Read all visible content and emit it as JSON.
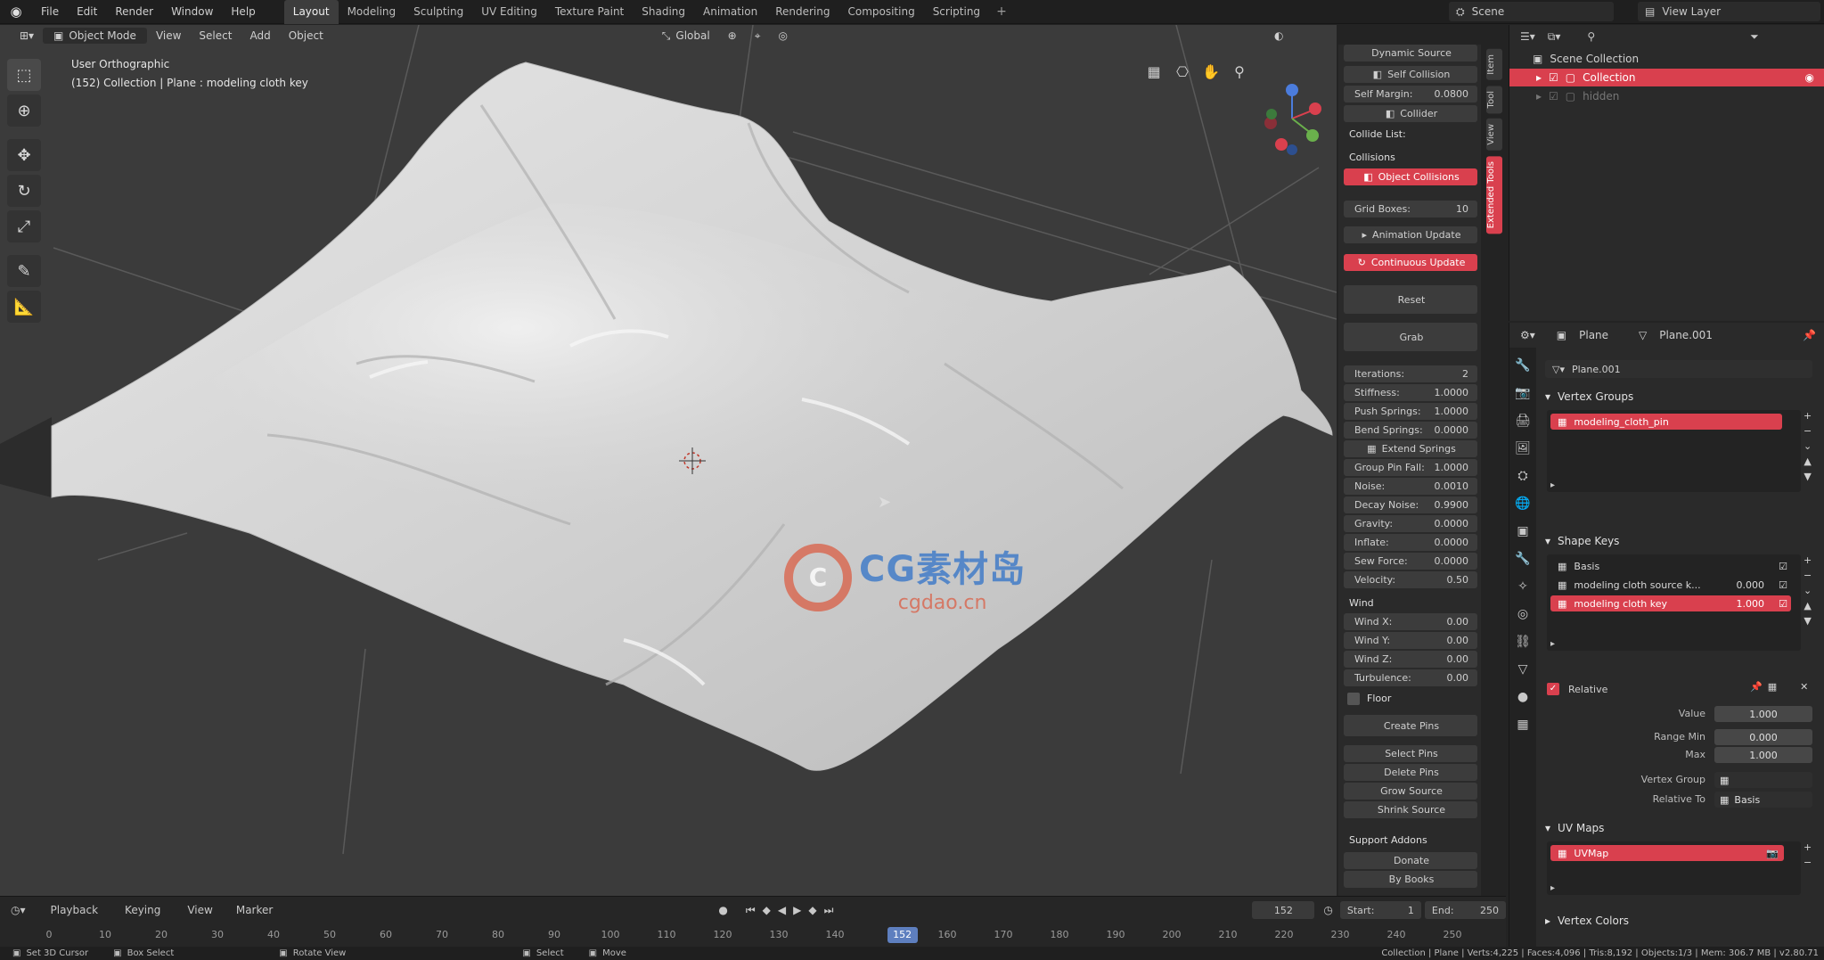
{
  "topbar": {
    "menus": [
      "File",
      "Edit",
      "Render",
      "Window",
      "Help"
    ],
    "tabs": [
      "Layout",
      "Modeling",
      "Sculpting",
      "UV Editing",
      "Texture Paint",
      "Shading",
      "Animation",
      "Rendering",
      "Compositing",
      "Scripting"
    ],
    "active_tab": "Layout",
    "add_tab": "+",
    "scene": "Scene",
    "view_layer": "View Layer"
  },
  "viewport": {
    "mode": "Object Mode",
    "menus": [
      "View",
      "Select",
      "Add",
      "Object"
    ],
    "orientation": "Global",
    "info_line1": "User Orthographic",
    "info_line2": "(152) Collection | Plane : modeling cloth key"
  },
  "watermark": {
    "logo_letter": "C",
    "big": "CG素材岛",
    "small": "cgdao.cn"
  },
  "npanel": {
    "dynamic_source": "Dynamic Source",
    "self_collision": "Self Collision",
    "self_margin_label": "Self Margin:",
    "self_margin_value": "0.0800",
    "collider": "Collider",
    "collide_list": "Collide List:",
    "collisions": "Collisions",
    "object_collisions": "Object Collisions",
    "grid_boxes_label": "Grid Boxes:",
    "grid_boxes_value": "10",
    "animation_update": "Animation Update",
    "continuous_update": "Continuous Update",
    "reset": "Reset",
    "grab": "Grab",
    "params": [
      {
        "label": "Iterations:",
        "value": "2"
      },
      {
        "label": "Stiffness:",
        "value": "1.0000"
      },
      {
        "label": "Push Springs:",
        "value": "1.0000"
      },
      {
        "label": "Bend Springs:",
        "value": "0.0000"
      }
    ],
    "extend_springs": "Extend Springs",
    "params2": [
      {
        "label": "Group Pin Fall:",
        "value": "1.0000"
      },
      {
        "label": "Noise:",
        "value": "0.0010"
      },
      {
        "label": "Decay Noise:",
        "value": "0.9900"
      },
      {
        "label": "Gravity:",
        "value": "0.0000"
      },
      {
        "label": "Inflate:",
        "value": "0.0000"
      },
      {
        "label": "Sew Force:",
        "value": "0.0000"
      },
      {
        "label": "Velocity:",
        "value": "0.50"
      }
    ],
    "wind": "Wind",
    "wind_params": [
      {
        "label": "Wind X:",
        "value": "0.00"
      },
      {
        "label": "Wind Y:",
        "value": "0.00"
      },
      {
        "label": "Wind Z:",
        "value": "0.00"
      },
      {
        "label": "Turbulence:",
        "value": "0.00"
      }
    ],
    "floor": "Floor",
    "create_pins": "Create Pins",
    "pin_buttons": [
      "Select Pins",
      "Delete Pins",
      "Grow Source",
      "Shrink Source"
    ],
    "support_addons": "Support Addons",
    "donate": "Donate",
    "by_books": "By Books"
  },
  "vtabs": [
    "Item",
    "Tool",
    "View",
    "Extended Tools"
  ],
  "outliner": {
    "scene_collection": "Scene Collection",
    "rows": [
      "Collection",
      "hidden"
    ]
  },
  "properties": {
    "object_name": "Plane",
    "mesh_name": "Plane.001",
    "data_name": "Plane.001",
    "vertex_groups_title": "Vertex Groups",
    "vertex_group_item": "modeling_cloth_pin",
    "shape_keys_title": "Shape Keys",
    "shape_keys": [
      {
        "name": "Basis",
        "value": ""
      },
      {
        "name": "modeling cloth source k...",
        "value": "0.000"
      },
      {
        "name": "modeling cloth key",
        "value": "1.000"
      }
    ],
    "relative_label": "Relative",
    "value_label": "Value",
    "value": "1.000",
    "range_min_label": "Range Min",
    "range_min": "0.000",
    "max_label": "Max",
    "max": "1.000",
    "vertex_group_label": "Vertex Group",
    "relative_to_label": "Relative To",
    "relative_to": "Basis",
    "uv_maps_title": "UV Maps",
    "uv_map_item": "UVMap",
    "vertex_colors_title": "Vertex Colors"
  },
  "timeline": {
    "menus": [
      "Playback",
      "Keying",
      "View",
      "Marker"
    ],
    "current_frame": "152",
    "start_label": "Start:",
    "start": "1",
    "end_label": "End:",
    "end": "250",
    "ticks": [
      "0",
      "10",
      "20",
      "30",
      "40",
      "50",
      "60",
      "70",
      "80",
      "90",
      "100",
      "110",
      "120",
      "130",
      "140",
      "152",
      "160",
      "170",
      "180",
      "190",
      "200",
      "210",
      "220",
      "230",
      "240",
      "250"
    ]
  },
  "statusbar": {
    "items": [
      "Set 3D Cursor",
      "Box Select",
      "Rotate View",
      "Select",
      "Move"
    ],
    "right": "Collection | Plane | Verts:4,225 | Faces:4,096 | Tris:8,192 | Objects:1/3 | Mem: 306.7 MB | v2.80.71"
  },
  "colors": {
    "accent": "#d9404e",
    "frame_marker": "#5e7fbf",
    "viewport_bg": "#3b3b3b",
    "cloth": "#d9d9d9"
  }
}
